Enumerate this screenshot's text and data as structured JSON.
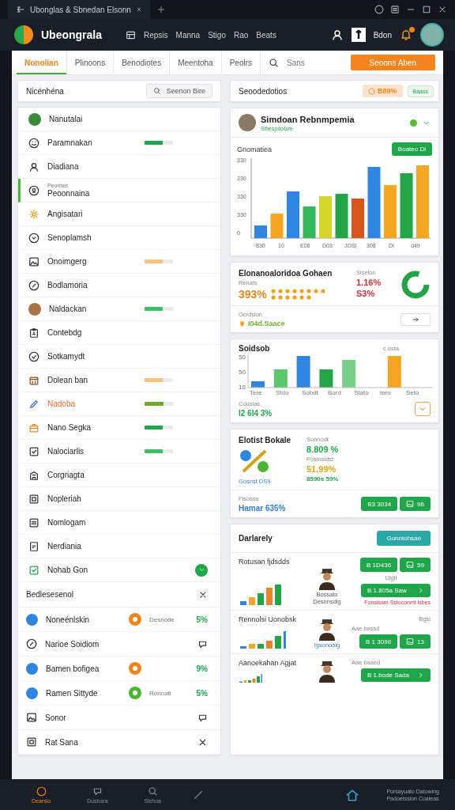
{
  "title_bar": {
    "tab_title": "Ubonglas & Sbnedan Elsonn"
  },
  "header": {
    "brand": "Ubeongrala",
    "nav": [
      "Repsis",
      "Manna",
      "Stigo",
      "Rao",
      "Beats"
    ],
    "user_label": "Bdon"
  },
  "tabs": [
    {
      "label": "Nonolian",
      "selected": true
    },
    {
      "label": "Plinoons",
      "selected": false
    },
    {
      "label": "Benodiotes",
      "selected": false
    },
    {
      "label": "Meentoha",
      "selected": false
    },
    {
      "label": "Peolrs",
      "selected": false
    }
  ],
  "search": {
    "placeholder": "Sans"
  },
  "primary_button": "Seoons Aben",
  "list_panel": {
    "title": "Nicénhéna",
    "search_button": "Seenon Bire",
    "items": [
      {
        "label": "Nanutalai",
        "selected": false,
        "highlighted": false
      },
      {
        "label": "Paramnakan",
        "selected": false,
        "highlighted": false,
        "level": 0.65,
        "color": "#1fa64a"
      },
      {
        "label": "Diadiana",
        "selected": false,
        "highlighted": false
      },
      {
        "label": "Peoonnaina",
        "subtitle": "Peordes",
        "selected": true,
        "highlighted": false
      },
      {
        "label": "Angisatari",
        "selected": false,
        "highlighted": false
      },
      {
        "label": "Senoplamsh",
        "selected": false,
        "highlighted": false
      },
      {
        "label": "Onoimgerg",
        "selected": false,
        "highlighted": false,
        "level": 0.65,
        "color": "#f7c27c"
      },
      {
        "label": "Bodlamoria",
        "selected": false,
        "highlighted": false
      },
      {
        "label": "Naldackan",
        "selected": false,
        "highlighted": false,
        "level": 0.65,
        "color": "#3cc065"
      },
      {
        "label": "Contebdg",
        "selected": false,
        "highlighted": false
      },
      {
        "label": "Sotkamydt",
        "selected": false,
        "highlighted": false
      },
      {
        "label": "Dolean ban",
        "selected": false,
        "highlighted": false,
        "level": 0.65,
        "color": "#f7c27c"
      },
      {
        "label": "Nadoba",
        "selected": false,
        "highlighted": true,
        "level": 0.68,
        "color": "#6cad2b"
      },
      {
        "label": "Nano Segka",
        "selected": false,
        "highlighted": false,
        "level": 0.65,
        "color": "#1fa64a"
      },
      {
        "label": "Nalociarlis",
        "selected": false,
        "highlighted": false,
        "level": 0.65,
        "color": "#3cc065"
      },
      {
        "label": "Corgriagta",
        "selected": false,
        "highlighted": false
      },
      {
        "label": "Nopleriah",
        "selected": false,
        "highlighted": false
      },
      {
        "label": "Nomlogam",
        "selected": false,
        "highlighted": false
      },
      {
        "label": "Nerdiania",
        "selected": false,
        "highlighted": false
      },
      {
        "label": "Nohab Gon",
        "selected": false,
        "highlighted": false
      }
    ]
  },
  "section": {
    "title": "Bedlesesenol",
    "rows": [
      {
        "label": "Noneénlskin",
        "color": "#f0841c",
        "status": "Desnode",
        "percent": "5%"
      },
      {
        "label": "Narioe Soidiom"
      },
      {
        "label": "Bamen bofigea",
        "color": "#f0841c",
        "percent": "9%"
      },
      {
        "label": "Ramen Sittyde",
        "color": "#4cb52f",
        "status": "Ronnati",
        "percent": "5%"
      },
      {
        "label": "Sonor"
      },
      {
        "label": "Rat Sana"
      }
    ]
  },
  "summary_bar": {
    "title": "Seoodedotios",
    "chip": "B89%",
    "button": "Baass"
  },
  "profile_card": {
    "name": "Simdoan Rebnmpemia",
    "subtitle": "Sibespdotsre",
    "chart_title": "Gnomatiea",
    "button": "Boateo Di",
    "y_labels": [
      "330",
      "230",
      "330",
      "330",
      "0"
    ],
    "x_labels": [
      "830",
      "10",
      "E08",
      "D03",
      "JOSI",
      "308",
      "DI",
      "d49"
    ]
  },
  "rating_card": {
    "title": "Elonanoaloridoa Gohaen",
    "label": "Renats",
    "value": "393%",
    "side_label": "Siseion",
    "side_values": [
      "1.16%",
      "S3%"
    ],
    "footer_label": "Ocrdsion",
    "footer_value": "I04d.Saace"
  },
  "sales_card": {
    "title": "Soidsob",
    "corner_label": "c osta",
    "y_labels": [
      "50",
      "50",
      "10"
    ],
    "x_labels": [
      "Tere",
      "Stdo",
      "Sobdt",
      "Bord",
      "Stato",
      "tero",
      "Seto"
    ],
    "footer_label": "Cousias",
    "footer_value": "I2 6I4 3%"
  },
  "stats_card": {
    "title": "Elotist Bokale",
    "image_caption": "Gosnst DS9",
    "metrics": [
      {
        "label": "Sonnodt",
        "value": "8.809 %",
        "color": "#1fa64a"
      },
      {
        "label": "Posinsidsf",
        "value": "51.99%",
        "color": "#d9a812"
      },
      {
        "value": "8590s 59%",
        "color": "#1fa64a"
      }
    ],
    "footer_label": "Fisosss",
    "footer_value": "Hamar 635%",
    "buttons": [
      {
        "label": "B3 3034",
        "kind": "text"
      },
      {
        "label": "96",
        "kind": "icon"
      }
    ]
  },
  "team_card": {
    "title": "Darlarely",
    "button": "Gonntohsan",
    "rows": [
      {
        "title": "Rotusan fjdsdds",
        "caption": "Bossato Desnnsdig",
        "buttons": [
          {
            "label": "B 1D436",
            "kind": "text"
          },
          {
            "label": "59",
            "kind": "icon"
          }
        ],
        "note": "Ulgit",
        "wide_button": "B 1.805a Saw",
        "alert": "Fonsisam Sstoconmt isbes"
      },
      {
        "title": "Rennolsi Uonobsk",
        "caption": "Igsonoaig",
        "meta": "Aae bassd",
        "corner": "Bgsi",
        "buttons": [
          {
            "label": "B 1 3098",
            "kind": "text"
          },
          {
            "label": "13",
            "kind": "icon"
          }
        ]
      },
      {
        "title": "Aanoekahan Agjat",
        "meta": "Aae baaed",
        "wide_button": "B 1.bode Sada"
      }
    ]
  },
  "bottom_nav": [
    {
      "label": "Dearsio",
      "selected": true
    },
    {
      "label": "Dusbora",
      "selected": false
    },
    {
      "label": "Sichoa",
      "selected": false
    }
  ],
  "footer_info": [
    "Porsayuato Datowing",
    "Padoetssion Coaleas"
  ]
}
